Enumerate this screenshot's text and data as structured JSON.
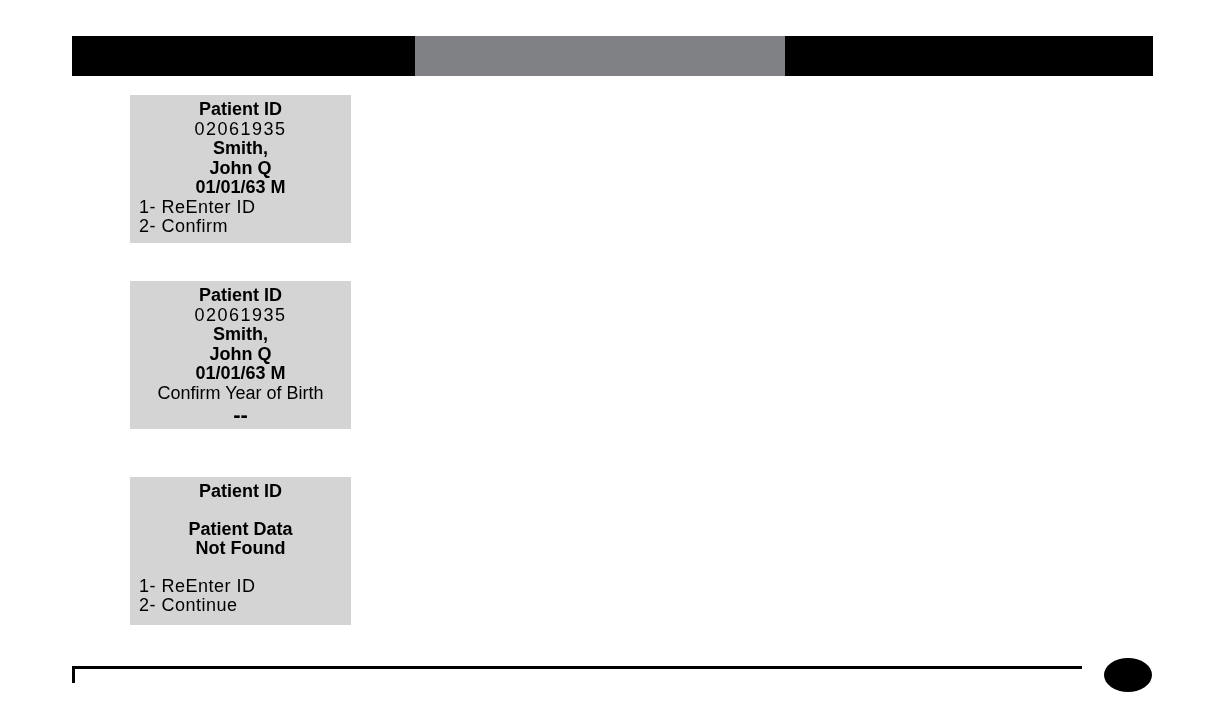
{
  "screens": [
    {
      "lines": [
        {
          "kind": "title",
          "text": "Patient ID"
        },
        {
          "kind": "number",
          "text": "02061935"
        },
        {
          "kind": "info",
          "text": "Smith,"
        },
        {
          "kind": "info",
          "text": "John Q"
        },
        {
          "kind": "info",
          "text": "01/01/63 M"
        },
        {
          "kind": "option",
          "text": "1- ReEnter ID"
        },
        {
          "kind": "option",
          "text": "2- Confirm"
        }
      ]
    },
    {
      "lines": [
        {
          "kind": "title",
          "text": "Patient ID"
        },
        {
          "kind": "number",
          "text": "02061935"
        },
        {
          "kind": "info",
          "text": "Smith,"
        },
        {
          "kind": "info",
          "text": "John Q"
        },
        {
          "kind": "info",
          "text": "01/01/63 M"
        },
        {
          "kind": "prompt",
          "text": "Confirm Year of Birth"
        },
        {
          "kind": "entry",
          "text": "--"
        }
      ]
    },
    {
      "lines": [
        {
          "kind": "title",
          "text": "Patient ID"
        },
        {
          "kind": "message",
          "text": "Patient Data"
        },
        {
          "kind": "message",
          "text": "Not Found"
        },
        {
          "kind": "option",
          "text": "1- ReEnter ID"
        },
        {
          "kind": "option",
          "text": "2- Continue"
        }
      ]
    }
  ]
}
